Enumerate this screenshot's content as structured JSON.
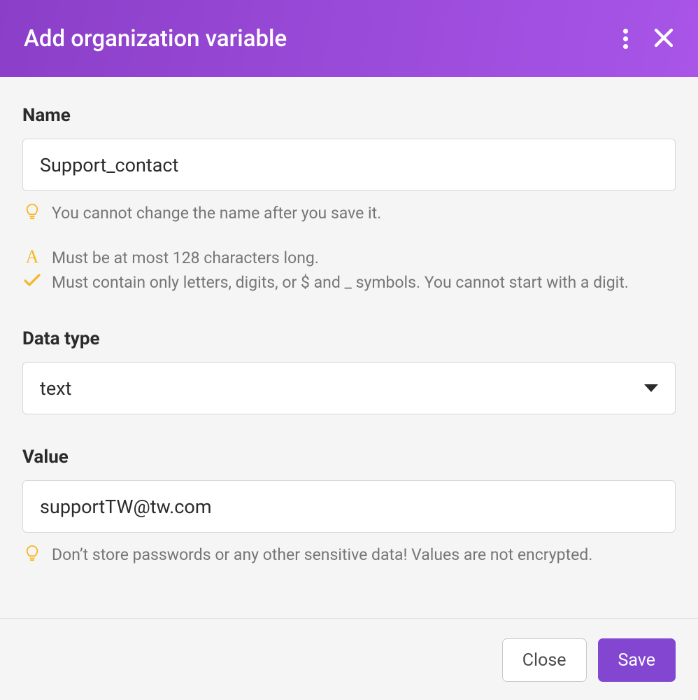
{
  "header": {
    "title": "Add organization variable"
  },
  "fields": {
    "name": {
      "label": "Name",
      "value": "Support_contact",
      "hint_tip": "You cannot change the name after you save it.",
      "rule_length": "Must be at most 128 characters long.",
      "rule_chars": "Must contain only letters, digits, or $ and _ symbols. You cannot start with a digit."
    },
    "data_type": {
      "label": "Data type",
      "value": "text"
    },
    "value": {
      "label": "Value",
      "value": "supportTW@tw.com",
      "hint_tip": "Don’t store passwords or any other sensitive data! Values are not encrypted."
    }
  },
  "footer": {
    "close_label": "Close",
    "save_label": "Save"
  }
}
